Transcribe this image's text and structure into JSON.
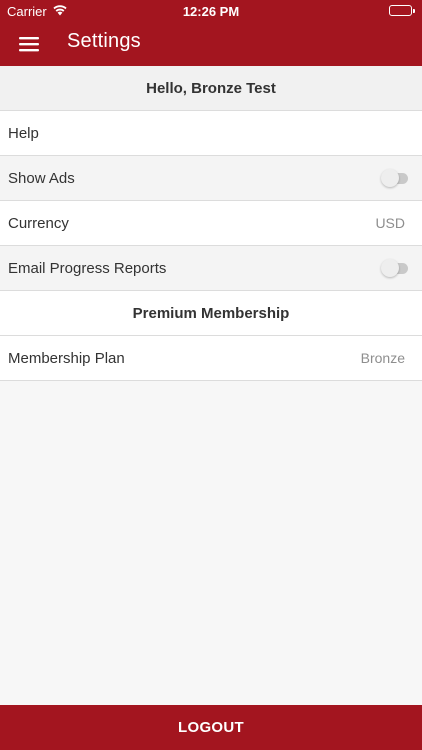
{
  "status_bar": {
    "carrier": "Carrier",
    "time": "12:26 PM",
    "battery_level": 1.0
  },
  "nav": {
    "title": "Settings",
    "menu_icon": "hamburger-menu-icon"
  },
  "settings": {
    "greeting": "Hello, Bronze Test",
    "help_label": "Help",
    "show_ads_label": "Show Ads",
    "show_ads_on": false,
    "currency_label": "Currency",
    "currency_value": "USD",
    "email_reports_label": "Email Progress Reports",
    "email_reports_on": false,
    "premium_header": "Premium Membership",
    "plan_label": "Membership Plan",
    "plan_value": "Bronze"
  },
  "footer": {
    "logout_label": "LOGOUT"
  },
  "colors": {
    "brand": "#a3151f",
    "background": "#f7f7f7",
    "divider": "#dcdcdc"
  }
}
